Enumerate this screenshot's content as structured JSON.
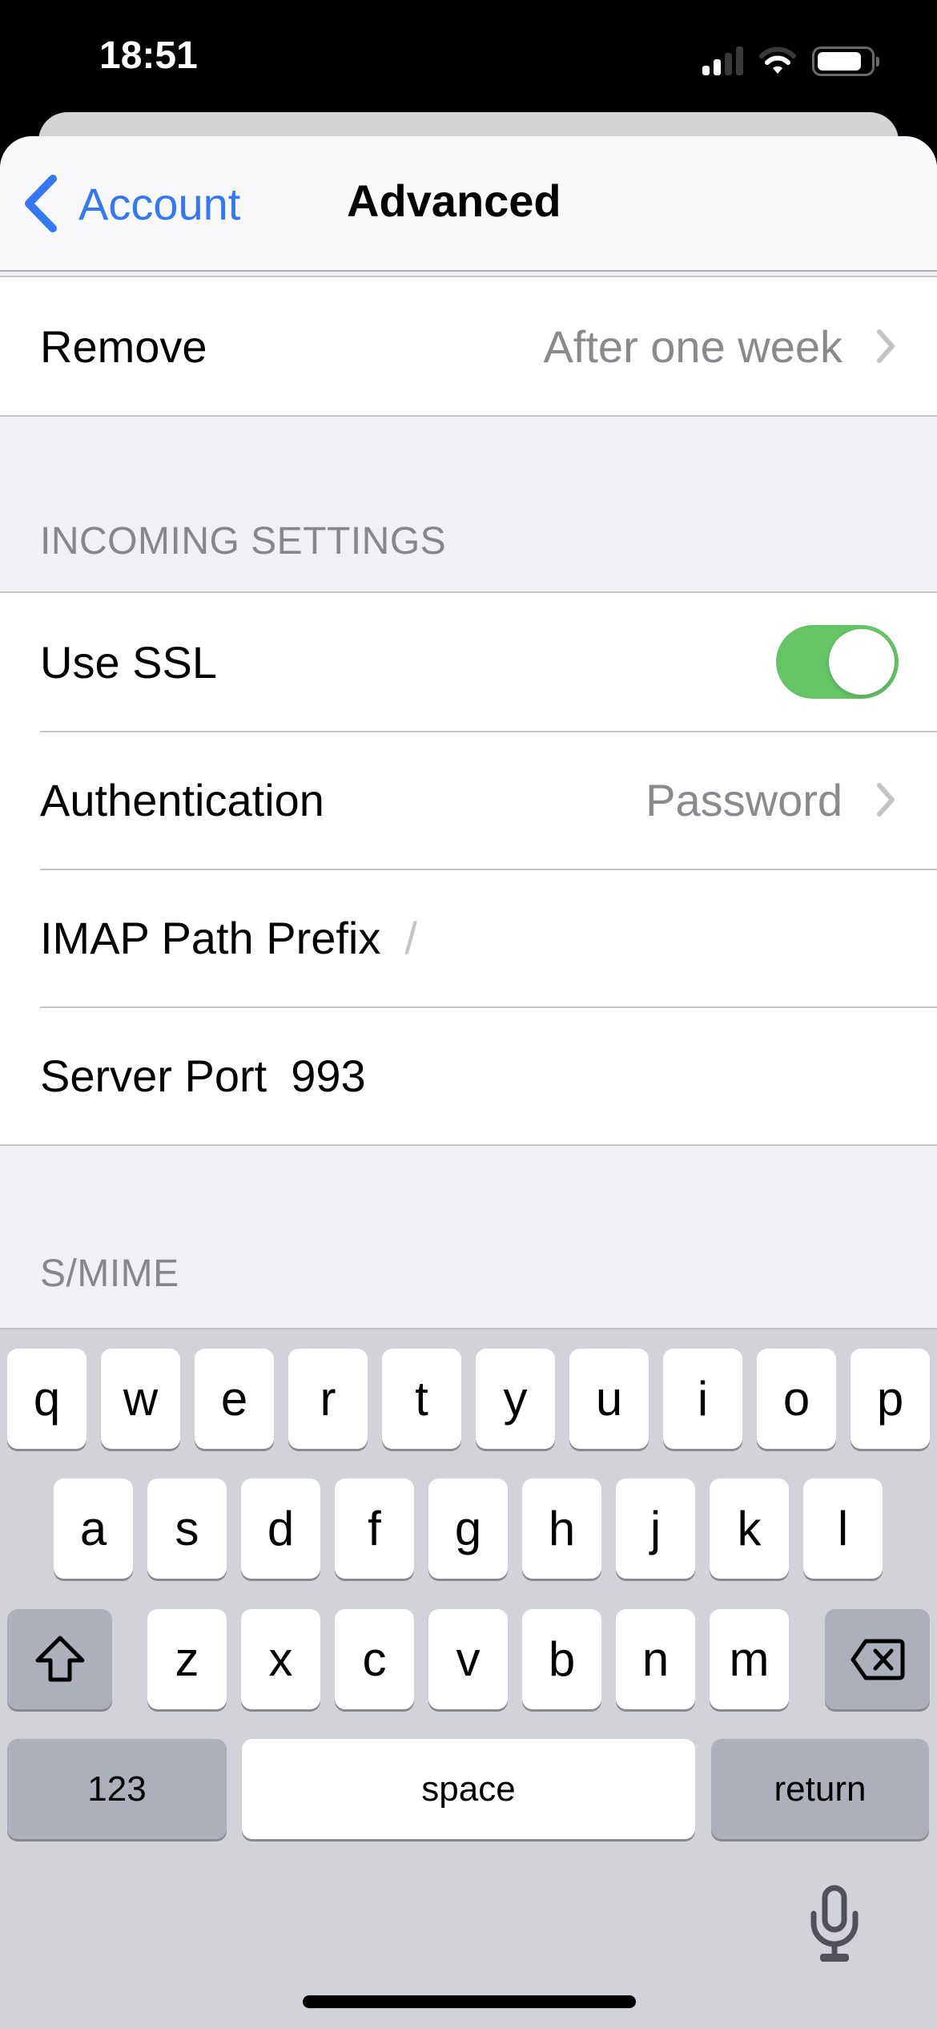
{
  "status_bar": {
    "time": "18:51",
    "signal_bars_active": 2,
    "signal_bars_total": 4,
    "wifi_arcs_active": 2,
    "wifi_arcs_total": 3,
    "battery_percent": 85
  },
  "nav": {
    "back_label": "Account",
    "title": "Advanced"
  },
  "colors": {
    "accent": "#3478F6",
    "toggle_on": "#65C466",
    "secondary_text": "#8A8A8E",
    "grouped_background": "#F0F0F5"
  },
  "rows": {
    "remove": {
      "label": "Remove",
      "value": "After one week"
    }
  },
  "incoming": {
    "header": "INCOMING SETTINGS",
    "use_ssl": {
      "label": "Use SSL",
      "enabled": true
    },
    "authentication": {
      "label": "Authentication",
      "value": "Password"
    },
    "imap_path_prefix": {
      "label": "IMAP Path Prefix",
      "value": "",
      "placeholder": "/"
    },
    "server_port": {
      "label": "Server Port",
      "value": "993"
    }
  },
  "smime": {
    "header": "S/MIME"
  },
  "keyboard": {
    "row1": [
      "q",
      "w",
      "e",
      "r",
      "t",
      "y",
      "u",
      "i",
      "o",
      "p"
    ],
    "row2": [
      "a",
      "s",
      "d",
      "f",
      "g",
      "h",
      "j",
      "k",
      "l"
    ],
    "row3": [
      "z",
      "x",
      "c",
      "v",
      "b",
      "n",
      "m"
    ],
    "numbers_label": "123",
    "space_label": "space",
    "return_label": "return"
  }
}
